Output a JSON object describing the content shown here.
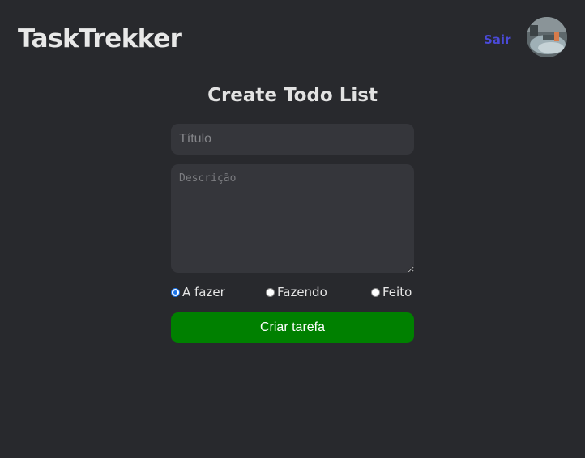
{
  "header": {
    "app_title": "TaskTrekker",
    "logout_label": "Sair",
    "avatar_icon": "user-avatar-icon"
  },
  "form": {
    "heading": "Create Todo List",
    "title_placeholder": "Título",
    "title_value": "",
    "description_placeholder": "Descrição",
    "description_value": "",
    "status_options": [
      {
        "label": "A fazer",
        "checked": true
      },
      {
        "label": "Fazendo",
        "checked": false
      },
      {
        "label": "Feito",
        "checked": false
      }
    ],
    "submit_label": "Criar tarefa"
  },
  "colors": {
    "background": "#28292d",
    "input_background": "#35363b",
    "logout_link": "#4a4ad8",
    "submit_button": "#008000",
    "radio_checked": "#1a73e8"
  }
}
